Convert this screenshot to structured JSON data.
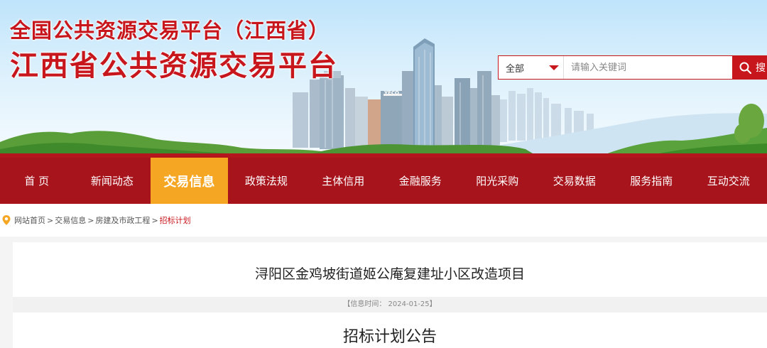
{
  "header": {
    "title_small": "全国公共资源交易平台（江西省）",
    "title_big": "江西省公共资源交易平台",
    "building_sign": "YECO"
  },
  "search": {
    "scope_selected": "全部",
    "placeholder": "请输入关键词",
    "button_label": "搜"
  },
  "nav": {
    "items": [
      {
        "label": "首 页"
      },
      {
        "label": "新闻动态"
      },
      {
        "label": "交易信息",
        "active": true
      },
      {
        "label": "政策法规"
      },
      {
        "label": "主体信用"
      },
      {
        "label": "金融服务"
      },
      {
        "label": "阳光采购"
      },
      {
        "label": "交易数据"
      },
      {
        "label": "服务指南"
      },
      {
        "label": "互动交流"
      }
    ]
  },
  "breadcrumb": {
    "items": [
      "网站首页",
      "交易信息",
      "房建及市政工程",
      "招标计划"
    ]
  },
  "article": {
    "title": "浔阳区金鸡坡街道姬公庵复建址小区改造项目",
    "meta": "【信息时间：  2024-01-25】",
    "subtitle": "招标计划公告"
  },
  "colors": {
    "brand_red": "#c8161d",
    "nav_red": "#a8141c",
    "nav_active": "#f5a623"
  }
}
